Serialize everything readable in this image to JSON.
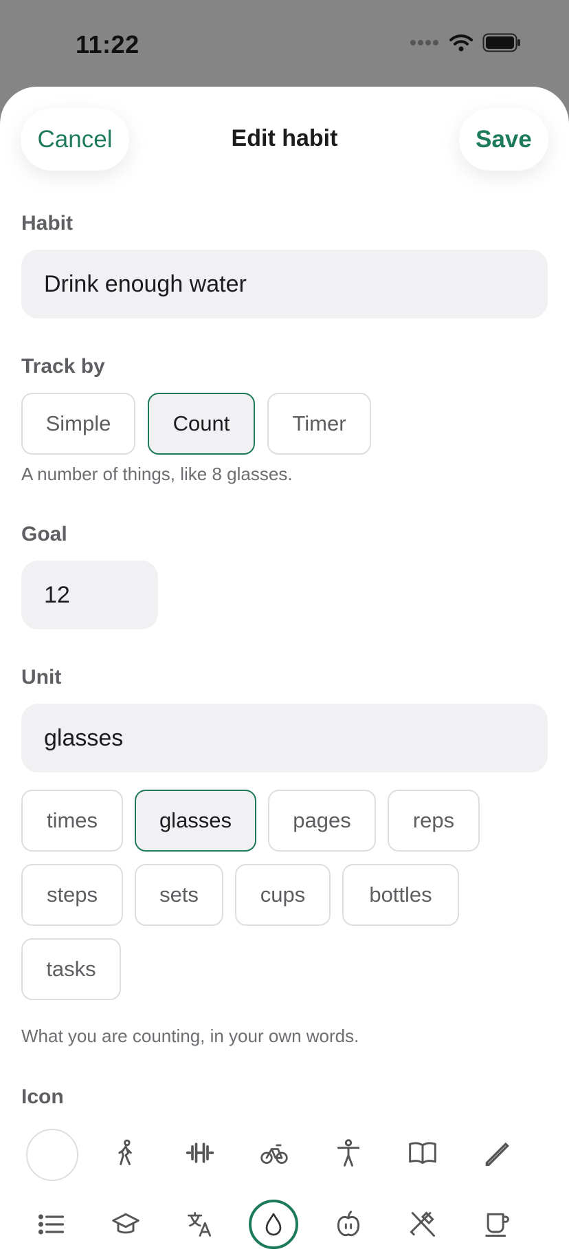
{
  "status_bar": {
    "time": "11:22"
  },
  "nav": {
    "cancel_label": "Cancel",
    "title": "Edit habit",
    "save_label": "Save"
  },
  "habit": {
    "label": "Habit",
    "value": "Drink enough water"
  },
  "track_by": {
    "label": "Track by",
    "options": [
      "Simple",
      "Count",
      "Timer"
    ],
    "selected": "Count",
    "hint": "A number of things, like 8 glasses."
  },
  "goal": {
    "label": "Goal",
    "value": "12"
  },
  "unit": {
    "label": "Unit",
    "value": "glasses",
    "options": [
      "times",
      "glasses",
      "pages",
      "reps",
      "steps",
      "sets",
      "cups",
      "bottles",
      "tasks"
    ],
    "selected": "glasses",
    "hint": "What you are counting, in your own words."
  },
  "icon_section": {
    "label": "Icon",
    "row1": [
      "no-icon",
      "walking-icon",
      "dumbbell-icon",
      "bicycle-icon",
      "accessibility-icon",
      "book-icon",
      "pencil-icon"
    ],
    "row2": [
      "list-icon",
      "graduation-cap-icon",
      "translate-icon",
      "water-drop-icon",
      "apple-icon",
      "fork-knife-icon",
      "coffee-cup-icon"
    ],
    "selected": "water-drop-icon"
  },
  "colors": {
    "accent": "#1d7a5b",
    "field_bg": "#f1f1f3",
    "backdrop": "#858585"
  }
}
